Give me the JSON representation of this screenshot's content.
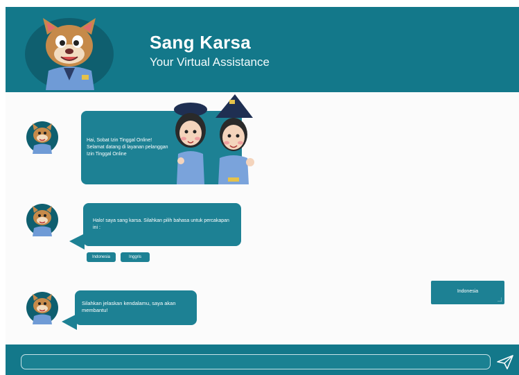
{
  "header": {
    "title": "Sang Karsa",
    "subtitle": "Your Virtual Assistance"
  },
  "messages": {
    "bot_1": "Hai, Sobat Izin Tinggal Online! Selamat datang di layanan pelanggan Izin Tinggal Online",
    "bot_2": "Halo! saya sang karsa. Silahkan pilih bahasa untuk percakapan ini :",
    "options": [
      "Indonesia",
      "Inggris"
    ],
    "user_reply": "Indonesia",
    "bot_3": "Silahkan jelaskan kendalamu, saya akan membantu!"
  },
  "footer": {
    "input_value": "",
    "input_placeholder": ""
  },
  "colors": {
    "brand": "#13788a",
    "bubble": "#1d8194",
    "background": "#fbfbfb"
  },
  "icons": {
    "assistant_avatar": "cat-mascot-avatar",
    "welcome_illustration": "officers-illustration",
    "send": "send-icon",
    "user_bubble_corner": "resize-grip-icon"
  }
}
